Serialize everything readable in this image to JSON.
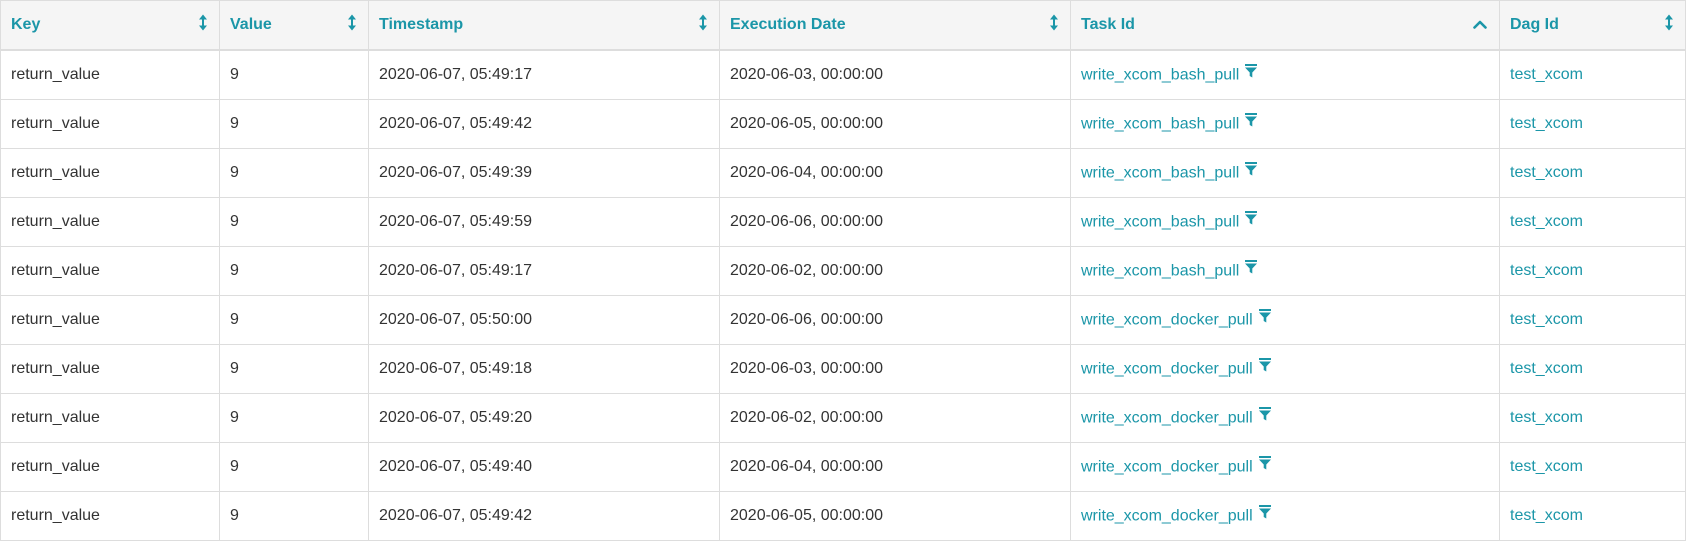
{
  "columns": [
    {
      "label": "Key",
      "sort_icon": "sort-both-icon"
    },
    {
      "label": "Value",
      "sort_icon": "sort-both-icon"
    },
    {
      "label": "Timestamp",
      "sort_icon": "sort-both-icon"
    },
    {
      "label": "Execution Date",
      "sort_icon": "sort-both-icon"
    },
    {
      "label": "Task Id",
      "sort_icon": "sort-asc-icon"
    },
    {
      "label": "Dag Id",
      "sort_icon": "sort-both-icon"
    }
  ],
  "rows": [
    {
      "key": "return_value",
      "value": "9",
      "timestamp": "2020-06-07, 05:49:17",
      "execution_date": "2020-06-03, 00:00:00",
      "task_id": "write_xcom_bash_pull",
      "dag_id": "test_xcom"
    },
    {
      "key": "return_value",
      "value": "9",
      "timestamp": "2020-06-07, 05:49:42",
      "execution_date": "2020-06-05, 00:00:00",
      "task_id": "write_xcom_bash_pull",
      "dag_id": "test_xcom"
    },
    {
      "key": "return_value",
      "value": "9",
      "timestamp": "2020-06-07, 05:49:39",
      "execution_date": "2020-06-04, 00:00:00",
      "task_id": "write_xcom_bash_pull",
      "dag_id": "test_xcom"
    },
    {
      "key": "return_value",
      "value": "9",
      "timestamp": "2020-06-07, 05:49:59",
      "execution_date": "2020-06-06, 00:00:00",
      "task_id": "write_xcom_bash_pull",
      "dag_id": "test_xcom"
    },
    {
      "key": "return_value",
      "value": "9",
      "timestamp": "2020-06-07, 05:49:17",
      "execution_date": "2020-06-02, 00:00:00",
      "task_id": "write_xcom_bash_pull",
      "dag_id": "test_xcom"
    },
    {
      "key": "return_value",
      "value": "9",
      "timestamp": "2020-06-07, 05:50:00",
      "execution_date": "2020-06-06, 00:00:00",
      "task_id": "write_xcom_docker_pull",
      "dag_id": "test_xcom"
    },
    {
      "key": "return_value",
      "value": "9",
      "timestamp": "2020-06-07, 05:49:18",
      "execution_date": "2020-06-03, 00:00:00",
      "task_id": "write_xcom_docker_pull",
      "dag_id": "test_xcom"
    },
    {
      "key": "return_value",
      "value": "9",
      "timestamp": "2020-06-07, 05:49:20",
      "execution_date": "2020-06-02, 00:00:00",
      "task_id": "write_xcom_docker_pull",
      "dag_id": "test_xcom"
    },
    {
      "key": "return_value",
      "value": "9",
      "timestamp": "2020-06-07, 05:49:40",
      "execution_date": "2020-06-04, 00:00:00",
      "task_id": "write_xcom_docker_pull",
      "dag_id": "test_xcom"
    },
    {
      "key": "return_value",
      "value": "9",
      "timestamp": "2020-06-07, 05:49:42",
      "execution_date": "2020-06-05, 00:00:00",
      "task_id": "write_xcom_docker_pull",
      "dag_id": "test_xcom"
    }
  ],
  "colors": {
    "link": "#1b96a8",
    "header_bg": "#f5f5f5",
    "border": "#dddddd",
    "text": "#333333"
  }
}
